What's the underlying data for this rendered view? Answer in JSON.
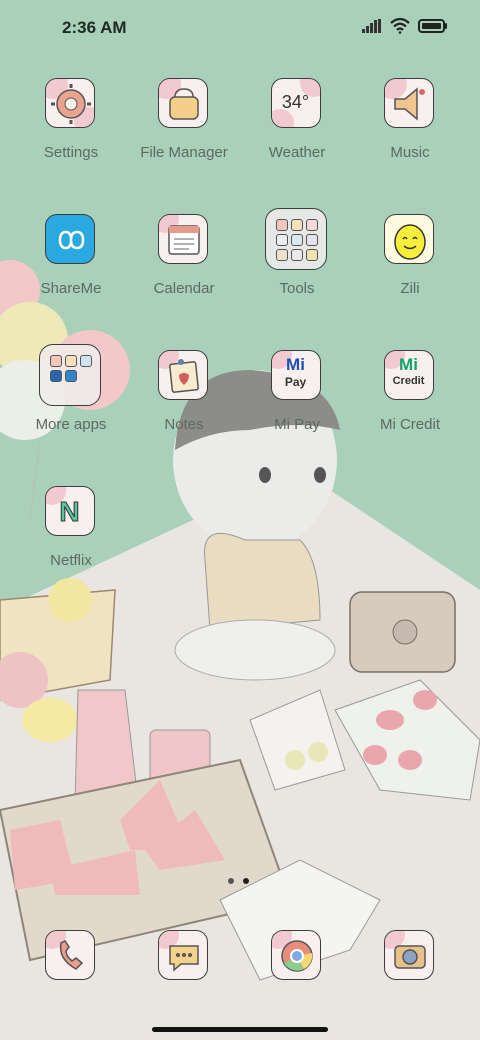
{
  "status": {
    "time": "2:36 AM"
  },
  "apps": [
    {
      "id": "settings",
      "label": "Settings",
      "icon": "settings-gear-icon"
    },
    {
      "id": "file-manager",
      "label": "File Manager",
      "icon": "folder-bag-icon"
    },
    {
      "id": "weather",
      "label": "Weather",
      "icon": "weather-icon",
      "value": "34°"
    },
    {
      "id": "music",
      "label": "Music",
      "icon": "music-speaker-icon"
    },
    {
      "id": "shareme",
      "label": "ShareMe",
      "icon": "shareme-icon"
    },
    {
      "id": "calendar",
      "label": "Calendar",
      "icon": "calendar-icon"
    },
    {
      "id": "tools",
      "label": "Tools",
      "icon": "tools-folder-icon"
    },
    {
      "id": "zili",
      "label": "Zili",
      "icon": "zili-icon"
    },
    {
      "id": "more-apps",
      "label": "More apps",
      "icon": "more-apps-folder-icon"
    },
    {
      "id": "notes",
      "label": "Notes",
      "icon": "notes-icon"
    },
    {
      "id": "mi-pay",
      "label": "Mi Pay",
      "icon": "mi-pay-icon",
      "badge_top": "Mi",
      "badge_bottom": "Pay"
    },
    {
      "id": "mi-credit",
      "label": "Mi Credit",
      "icon": "mi-credit-icon",
      "badge_top": "Mi",
      "badge_bottom": "Credit"
    },
    {
      "id": "netflix",
      "label": "Netflix",
      "icon": "netflix-icon",
      "badge_top": "N"
    }
  ],
  "dock": [
    {
      "id": "phone",
      "icon": "phone-icon"
    },
    {
      "id": "messages",
      "icon": "messages-icon"
    },
    {
      "id": "chrome",
      "icon": "chrome-icon"
    },
    {
      "id": "camera",
      "icon": "camera-icon"
    }
  ],
  "page_indicator": {
    "pages": 2,
    "active": 2
  }
}
